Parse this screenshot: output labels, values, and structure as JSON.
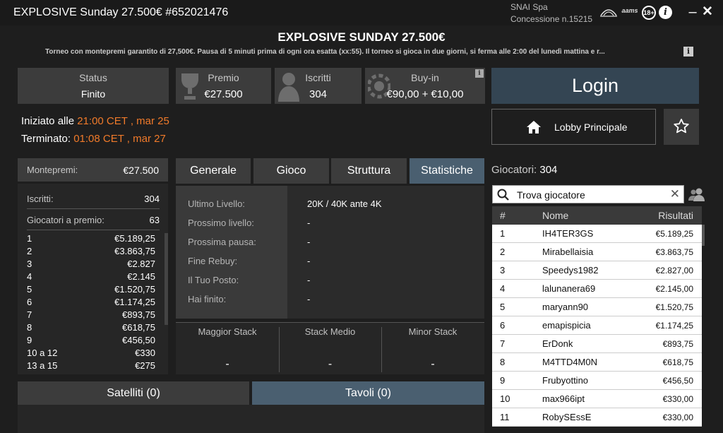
{
  "window": {
    "title": "EXPLOSIVE Sunday 27.500€ #652021476",
    "operator": "SNAI Spa",
    "concession": "Concessione n.15215",
    "badge_18": "18+",
    "info_glyph": "i",
    "aams": "aams",
    "minimize": "–",
    "close": "✕"
  },
  "tournament": {
    "title": "EXPLOSIVE SUNDAY 27.500€",
    "description": "Torneo con montepremi garantito di 27,500€. Pausa di 5 minuti prima di ogni ora esatta (xx:55). Il torneo si gioca in due giorni, si ferma alle 2:00 del lunedì mattina e r...",
    "info_glyph": "i"
  },
  "stats": [
    {
      "label": "Status",
      "value": "Finito"
    },
    {
      "label": "Premio",
      "value": "€27.500"
    },
    {
      "label": "Iscritti",
      "value": "304"
    },
    {
      "label": "Buy-in",
      "value": "€90,00 + €10,00"
    }
  ],
  "times": {
    "started_label": "Iniziato alle ",
    "started_value": "21:00 CET , mar 25",
    "ended_label": "Terminato: ",
    "ended_value": "01:08 CET , mar 27"
  },
  "actions": {
    "login": "Login",
    "lobby": "Lobby Principale"
  },
  "prize": {
    "head_label": "Montepremi:",
    "head_value": "€27.500",
    "entrants_label": "Iscritti:",
    "entrants_value": "304",
    "paid_label": "Giocatori a premio:",
    "paid_value": "63",
    "rows": [
      {
        "pos": "1",
        "amount": "€5.189,25"
      },
      {
        "pos": "2",
        "amount": "€3.863,75"
      },
      {
        "pos": "3",
        "amount": "€2.827"
      },
      {
        "pos": "4",
        "amount": "€2.145"
      },
      {
        "pos": "5",
        "amount": "€1.520,75"
      },
      {
        "pos": "6",
        "amount": "€1.174,25"
      },
      {
        "pos": "7",
        "amount": "€893,75"
      },
      {
        "pos": "8",
        "amount": "€618,75"
      },
      {
        "pos": "9",
        "amount": "€456,50"
      },
      {
        "pos": "10 a 12",
        "amount": "€330"
      },
      {
        "pos": "13 a 15",
        "amount": "€275"
      }
    ]
  },
  "tabs": [
    "Generale",
    "Gioco",
    "Struttura",
    "Statistiche"
  ],
  "stats_panel": {
    "rows": [
      {
        "label": "Ultimo Livello:",
        "value": "20K / 40K ante 4K"
      },
      {
        "label": "Prossimo livello:",
        "value": "-"
      },
      {
        "label": "Prossima pausa:",
        "value": "-"
      },
      {
        "label": "Fine Rebuy:",
        "value": "-"
      },
      {
        "label": "Il Tuo Posto:",
        "value": "-"
      },
      {
        "label": "Hai finito:",
        "value": "-"
      }
    ],
    "stacks": [
      {
        "label": "Maggior Stack",
        "value": "-"
      },
      {
        "label": "Stack Medio",
        "value": "-"
      },
      {
        "label": "Minor Stack",
        "value": "-"
      }
    ]
  },
  "bottom_tabs": {
    "satelliti": "Satelliti (0)",
    "tavoli": "Tavoli (0)"
  },
  "players": {
    "count_label": "Giocatori:",
    "count_value": "304",
    "search_value": "Trova giocatore",
    "clear_glyph": "✕",
    "headers": {
      "pos": "#",
      "name": "Nome",
      "result": "Risultati"
    },
    "rows": [
      {
        "pos": "1",
        "name": "IH4TER3GS",
        "result": "€5.189,25"
      },
      {
        "pos": "2",
        "name": "Mirabellaisia",
        "result": "€3.863,75"
      },
      {
        "pos": "3",
        "name": "Speedys1982",
        "result": "€2.827,00"
      },
      {
        "pos": "4",
        "name": "lalunanera69",
        "result": "€2.145,00"
      },
      {
        "pos": "5",
        "name": "maryann90",
        "result": "€1.520,75"
      },
      {
        "pos": "6",
        "name": "emapispicia",
        "result": "€1.174,25"
      },
      {
        "pos": "7",
        "name": "ErDonk",
        "result": "€893,75"
      },
      {
        "pos": "8",
        "name": "M4TTD4M0N",
        "result": "€618,75"
      },
      {
        "pos": "9",
        "name": "Frubyottino",
        "result": "€456,50"
      },
      {
        "pos": "10",
        "name": "max966ipt",
        "result": "€330,00"
      },
      {
        "pos": "11",
        "name": "RobySEssE",
        "result": "€330,00"
      }
    ]
  },
  "colors": {
    "accent": "#f07a2a",
    "tab_active": "#4a5f70",
    "login_bg": "#344553"
  }
}
